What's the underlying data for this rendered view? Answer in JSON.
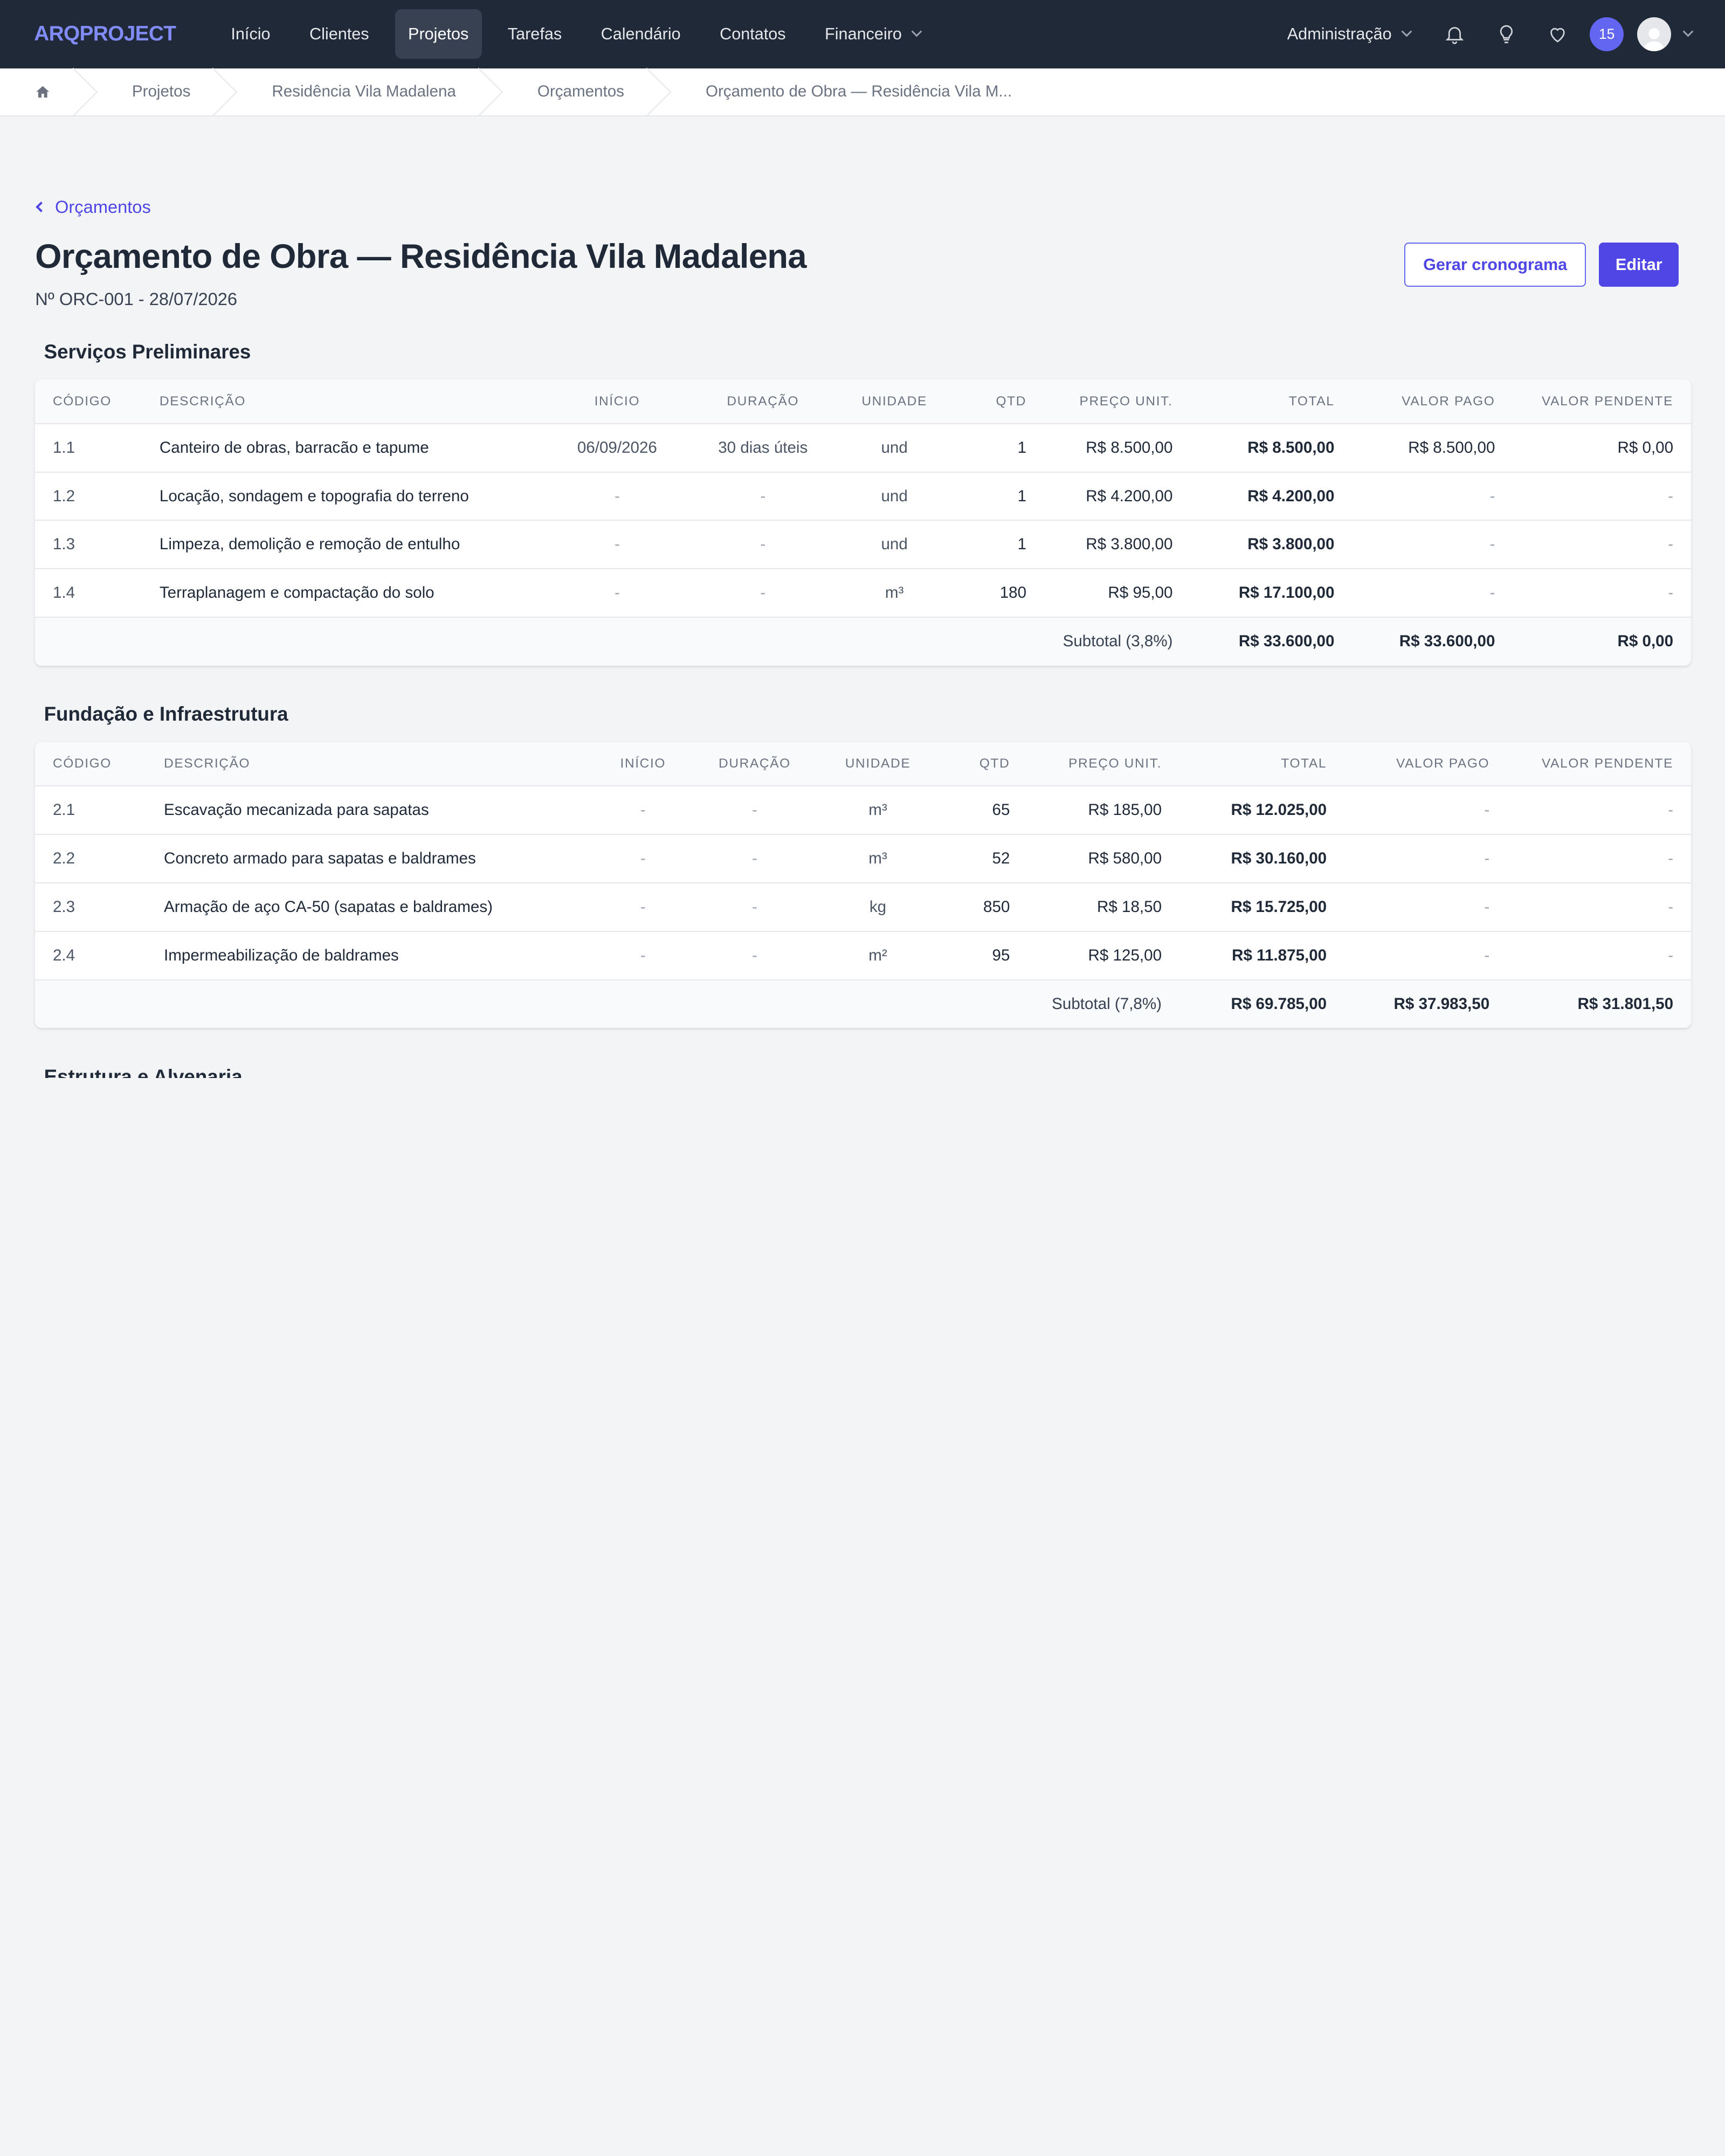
{
  "nav": {
    "logo": "ARQPROJECT",
    "items": [
      {
        "label": "Início"
      },
      {
        "label": "Clientes"
      },
      {
        "label": "Projetos"
      },
      {
        "label": "Tarefas"
      },
      {
        "label": "Calendário"
      },
      {
        "label": "Contatos"
      },
      {
        "label": "Financeiro"
      }
    ],
    "admin_label": "Administração",
    "notification_count": "15"
  },
  "breadcrumb": {
    "items": [
      "Projetos",
      "Residência Vila Madalena",
      "Orçamentos",
      "Orçamento de Obra — Residência Vila M..."
    ]
  },
  "page": {
    "back_label": "Orçamentos",
    "title": "Orçamento de Obra — Residência Vila Madalena",
    "subtitle": "Nº ORC-001 - 28/07/2026",
    "btn_cronograma": "Gerar cronograma",
    "btn_editar": "Editar"
  },
  "columns": [
    "Código",
    "Descrição",
    "Início",
    "Duração",
    "Unidade",
    "Qtd",
    "Preço Unit.",
    "Total",
    "Valor Pago",
    "Valor Pendente"
  ],
  "sections": [
    {
      "title": "Serviços Preliminares",
      "rows": [
        [
          "1.1",
          "Canteiro de obras, barracão e tapume",
          "06/09/2026",
          "30 dias úteis",
          "und",
          "1",
          "R$ 8.500,00",
          "R$ 8.500,00",
          "R$ 8.500,00",
          "R$ 0,00"
        ],
        [
          "1.2",
          "Locação, sondagem e topografia do terreno",
          "-",
          "-",
          "und",
          "1",
          "R$ 4.200,00",
          "R$ 4.200,00",
          "-",
          "-"
        ],
        [
          "1.3",
          "Limpeza, demolição e remoção de entulho",
          "-",
          "-",
          "und",
          "1",
          "R$ 3.800,00",
          "R$ 3.800,00",
          "-",
          "-"
        ],
        [
          "1.4",
          "Terraplanagem e compactação do solo",
          "-",
          "-",
          "m³",
          "180",
          "R$ 95,00",
          "R$ 17.100,00",
          "-",
          "-"
        ]
      ],
      "subtotal": {
        "label": "Subtotal (3,8%)",
        "total": "R$ 33.600,00",
        "pago": "R$ 33.600,00",
        "pendente": "R$ 0,00"
      }
    },
    {
      "title": "Fundação e Infraestrutura",
      "rows": [
        [
          "2.1",
          "Escavação mecanizada para sapatas",
          "-",
          "-",
          "m³",
          "65",
          "R$ 185,00",
          "R$ 12.025,00",
          "-",
          "-"
        ],
        [
          "2.2",
          "Concreto armado para sapatas e baldrames",
          "-",
          "-",
          "m³",
          "52",
          "R$ 580,00",
          "R$ 30.160,00",
          "-",
          "-"
        ],
        [
          "2.3",
          "Armação de aço CA-50 (sapatas e baldrames)",
          "-",
          "-",
          "kg",
          "850",
          "R$ 18,50",
          "R$ 15.725,00",
          "-",
          "-"
        ],
        [
          "2.4",
          "Impermeabilização de baldrames",
          "-",
          "-",
          "m²",
          "95",
          "R$ 125,00",
          "R$ 11.875,00",
          "-",
          "-"
        ]
      ],
      "subtotal": {
        "label": "Subtotal (7,8%)",
        "total": "R$ 69.785,00",
        "pago": "R$ 37.983,50",
        "pendente": "R$ 31.801,50"
      }
    },
    {
      "title": "Estrutura e Alvenaria"
    }
  ]
}
